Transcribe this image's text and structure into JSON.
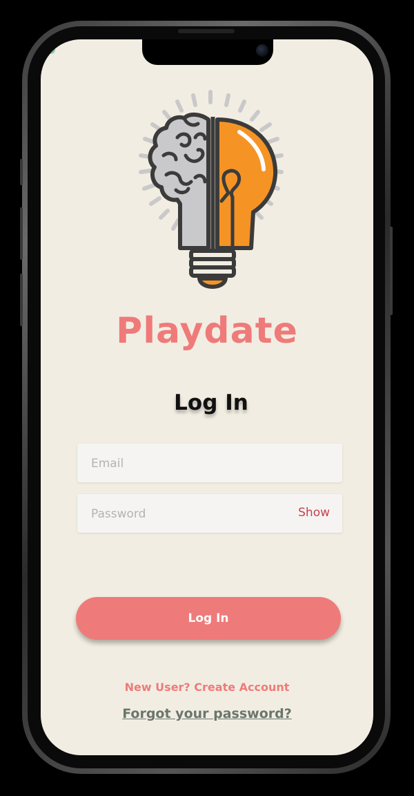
{
  "app": {
    "title": "Playdate",
    "logo_icon": "brain-lightbulb-icon"
  },
  "login": {
    "heading": "Log In",
    "email_placeholder": "Email",
    "email_value": "",
    "password_placeholder": "Password",
    "password_value": "",
    "show_label": "Show",
    "submit_label": "Log In",
    "create_account_label": "New User? Create Account",
    "forgot_password_label": "Forgot your password?"
  },
  "colors": {
    "background": "#f2ede2",
    "accent": "#ee7b7a",
    "show_text": "#c8404a",
    "forgot_link": "#6a766c",
    "bulb_orange": "#f59425",
    "brain_gray": "#c8c8c8"
  }
}
